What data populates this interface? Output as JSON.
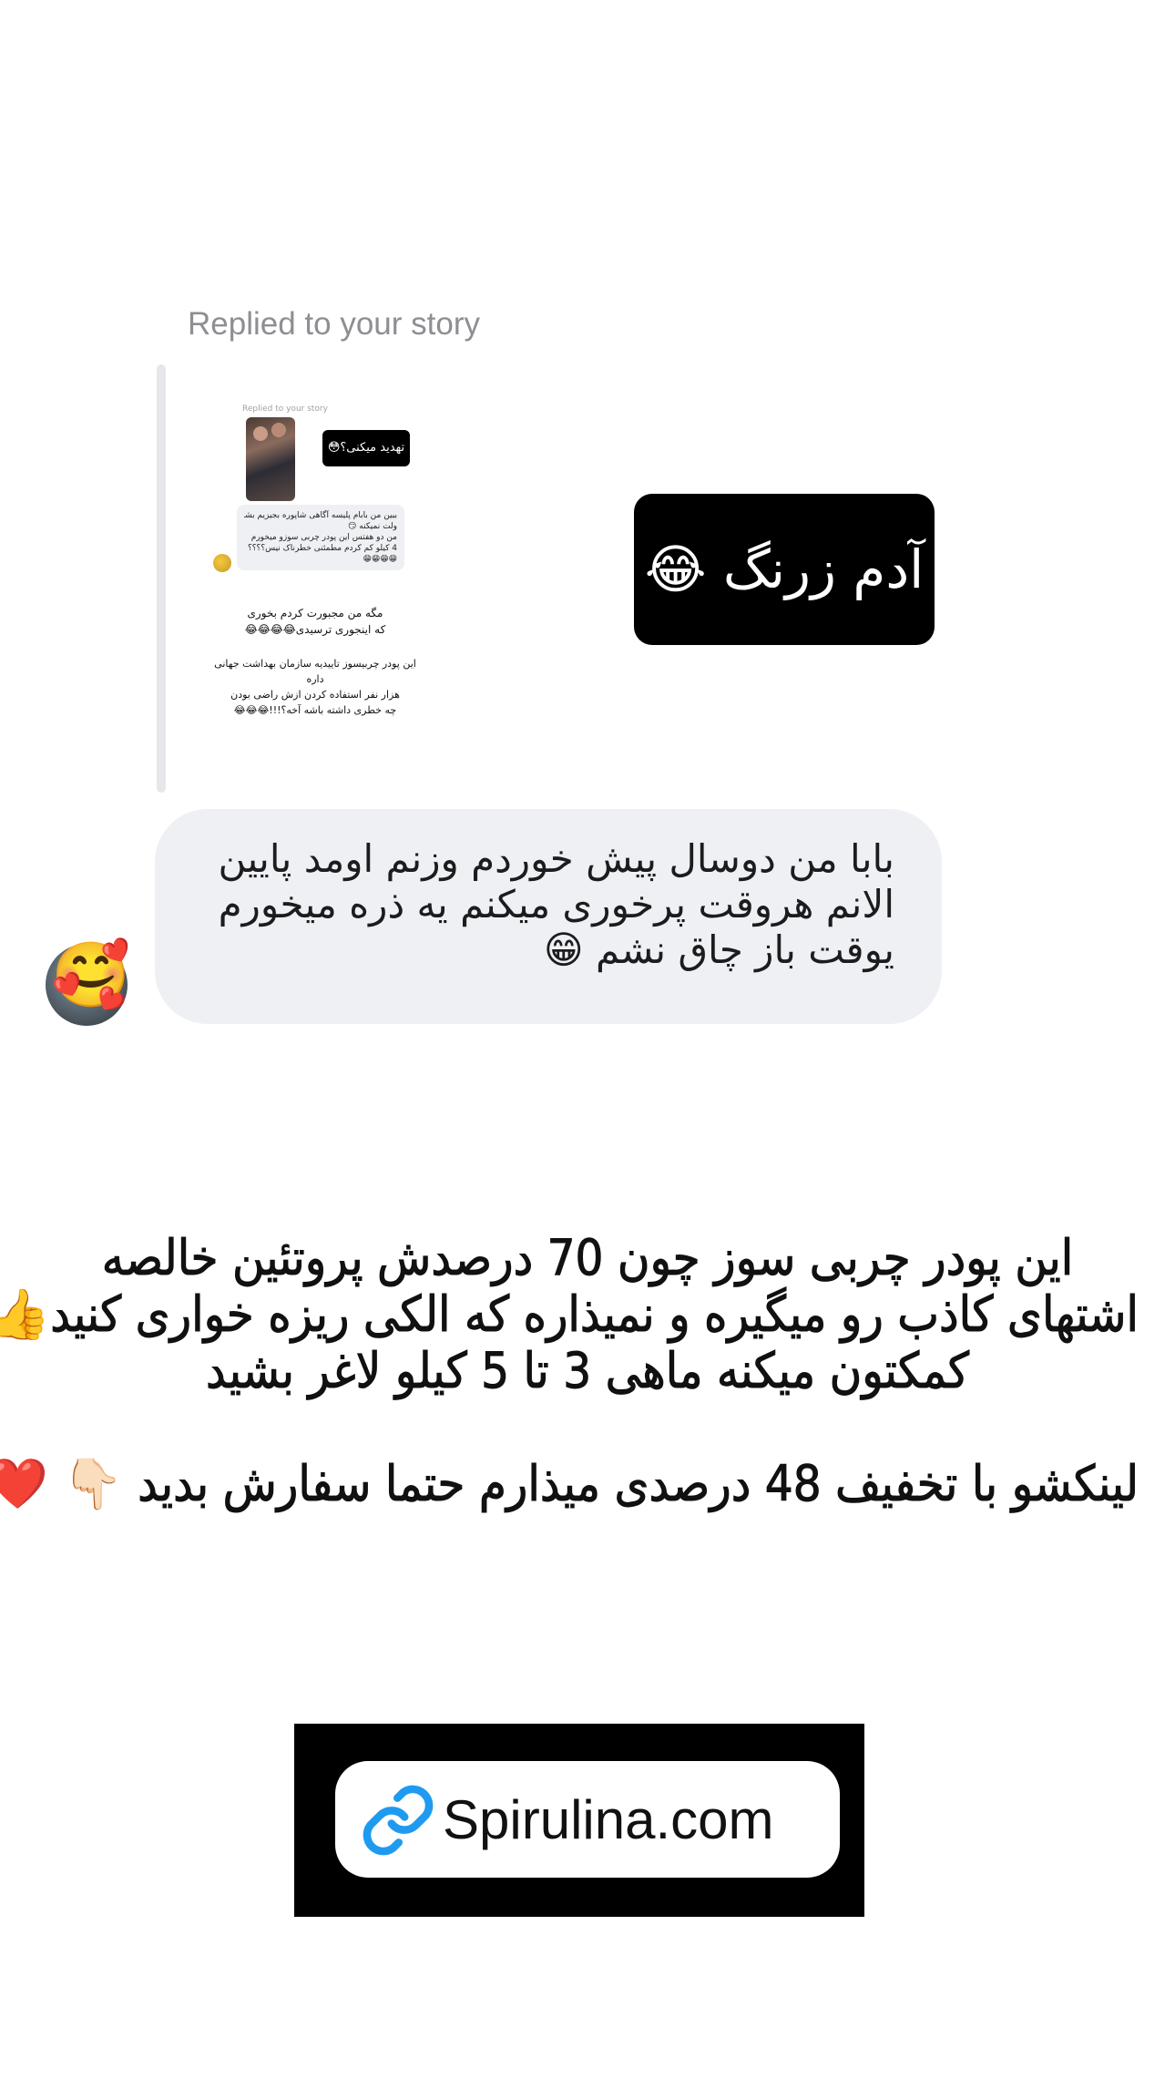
{
  "reply_header": "Replied to your story",
  "story_preview": {
    "replied_label": "Replied to your story",
    "badge_text": "تهدید میکنی؟😳",
    "bubble_lines": [
      "ببین من بابام پلیسه آگاهی شاپوره بجیزیم بشه",
      "ولت نمیکنه 😏",
      "من دو هفتس این پودر چربی سوزو میخورم",
      "4 کیلو کم کردم مطمئنی خطرناک نیس؟؟؟؟",
      "😁😁😁😁"
    ],
    "text_lines_1": [
      "مگه من مجبورت کردم بخوری",
      "که اینجوری ترسیدی😂😂😂😂"
    ],
    "text_lines_2": [
      "این پودر چربیسوز تاییدیه سازمان بهداشت جهانی داره",
      "هزار نفر استفاده کردن ازش راضی بودن",
      "چه خطری داشته باشه آخه؟!!!😂😂😂"
    ]
  },
  "story_reply_label": "آدم زرنگ 😂",
  "message": {
    "lines": [
      "بابا من دوسال پیش خوردم وزنم اومد پایین",
      "الانم هروقت پرخوری میکنم یه ذره میخورم",
      "یوقت باز چاق نشم 😁"
    ],
    "avatar_emoji": "🥰"
  },
  "caption": {
    "lines": [
      "این پودر چربی سوز چون 70 درصدش پروتئین خالصه",
      "اشتهای کاذب رو میگیره  و نمیذاره که الکی ریزه خواری کنید👍",
      "کمکتون میکنه ماهی 3 تا 5 کیلو لاغر بشید"
    ],
    "cta": "لینکشو با تخفیف 48 درصدی میذارم حتما سفارش بدید 👇🏻 ❤️"
  },
  "link_sticker": {
    "text": "Spirulina.com",
    "icon": "link-icon",
    "icon_color": "#1e9bf0"
  }
}
